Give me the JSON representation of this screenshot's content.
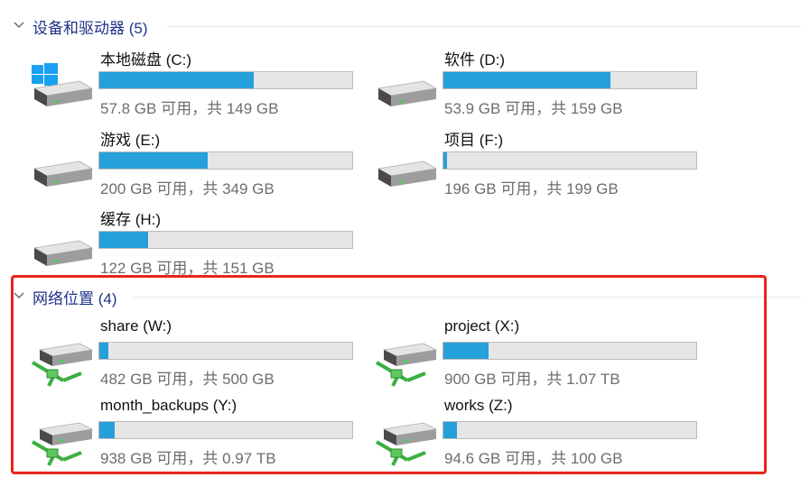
{
  "groups": {
    "devices": {
      "title": "设备和驱动器 (5)"
    },
    "network": {
      "title": "网络位置 (4)"
    }
  },
  "drives": [
    {
      "name": "本地磁盘 (C:)",
      "space": "57.8 GB 可用，共 149 GB",
      "used_fraction": 0.612,
      "icon": "windows-drive-icon"
    },
    {
      "name": "软件 (D:)",
      "space": "53.9 GB 可用，共 159 GB",
      "used_fraction": 0.661,
      "icon": "hard-drive-icon"
    },
    {
      "name": "游戏 (E:)",
      "space": "200 GB 可用，共 349 GB",
      "used_fraction": 0.427,
      "icon": "hard-drive-icon"
    },
    {
      "name": "项目 (F:)",
      "space": "196 GB 可用，共 199 GB",
      "used_fraction": 0.015,
      "icon": "hard-drive-icon"
    },
    {
      "name": "缓存 (H:)",
      "space": "122 GB 可用，共 151 GB",
      "used_fraction": 0.192,
      "icon": "hard-drive-icon"
    }
  ],
  "network_drives": [
    {
      "name": "share (W:)",
      "space": "482 GB 可用，共 500 GB",
      "used_fraction": 0.036,
      "icon": "network-drive-icon"
    },
    {
      "name": "project (X:)",
      "space": "900 GB 可用，共 1.07 TB",
      "used_fraction": 0.18,
      "icon": "network-drive-icon"
    },
    {
      "name": "month_backups (Y:)",
      "space": "938 GB 可用，共 0.97 TB",
      "used_fraction": 0.06,
      "icon": "network-drive-icon"
    },
    {
      "name": "works (Z:)",
      "space": "94.6 GB 可用，共 100 GB",
      "used_fraction": 0.054,
      "icon": "network-drive-icon"
    }
  ],
  "colors": {
    "bar_fill": "#26a0da",
    "bar_bg": "#e6e6e6",
    "group_title": "#1e3287",
    "highlight": "#e8241c"
  }
}
